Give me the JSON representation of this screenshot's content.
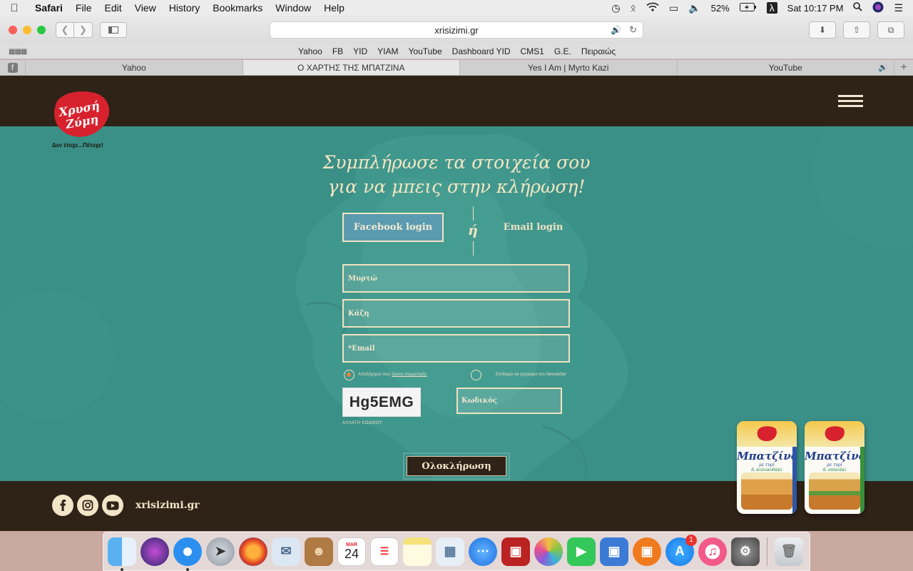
{
  "menubar": {
    "app": "Safari",
    "items": [
      "File",
      "Edit",
      "View",
      "History",
      "Bookmarks",
      "Window",
      "Help"
    ],
    "battery": "52%",
    "clock": "Sat 10:17 PM",
    "input_indicator": "λ"
  },
  "toolbar": {
    "url": "xrisizimi.gr"
  },
  "bookmarks": [
    "Yahoo",
    "FB",
    "YID",
    "YIAM",
    "YouTube",
    "Dashboard YID",
    "CMS1",
    "G.E.",
    "Πειραιώς"
  ],
  "tabs": [
    {
      "label": "Yahoo"
    },
    {
      "label": "Ο ΧΑΡΤΗΣ ΤΗΣ ΜΠΑΤΖΙΝΑ"
    },
    {
      "label": "Yes I Am | Myrto Kazi"
    },
    {
      "label": "YouTube"
    }
  ],
  "site": {
    "logo_text_line1": "Χρυσή",
    "logo_text_line2": "Ζύμη",
    "tagline": "Δεν έτυχε...Πέτυχε!",
    "headline_line1": "Συμπλήρωσε τα στοιχεία σου",
    "headline_line2": "για να μπεις στην κλήρωση!",
    "facebook_login": "Facebook login",
    "or": "ή",
    "email_login": "Email login",
    "first_name_value": "Μυρτώ",
    "last_name_value": "Κάζη",
    "email_placeholder": "*Email",
    "terms_prefix": "Αποδέχομαι τους ",
    "terms_link": "όρους συμμετοχής",
    "newsletter_label": "Επιθυμώ να εγγραφώ στο Newsletter",
    "captcha": "Hg5EMG",
    "captcha_change": "ΑΛΛΑΓΗ ΚΩΔΙΚΟΥ",
    "code_placeholder": "Κωδικός",
    "submit": "Ολοκλήρωση",
    "footer_site": "xrisizimi.gr"
  },
  "products": [
    {
      "name": "Μπατζίνα",
      "sub1": "με τυρί",
      "sub2": "& κολοκυθάκι"
    },
    {
      "name": "Μπατζίνα",
      "sub1": "με τυρί",
      "sub2": "& σπανάκι"
    }
  ],
  "dock": {
    "calendar_month": "MAR",
    "calendar_day": "24",
    "appstore_badge": "1"
  },
  "colors": {
    "teal_bg": "#3a8f86",
    "brown": "#2f2217",
    "cream": "#f1e3c3",
    "brand_red": "#d7222e"
  }
}
